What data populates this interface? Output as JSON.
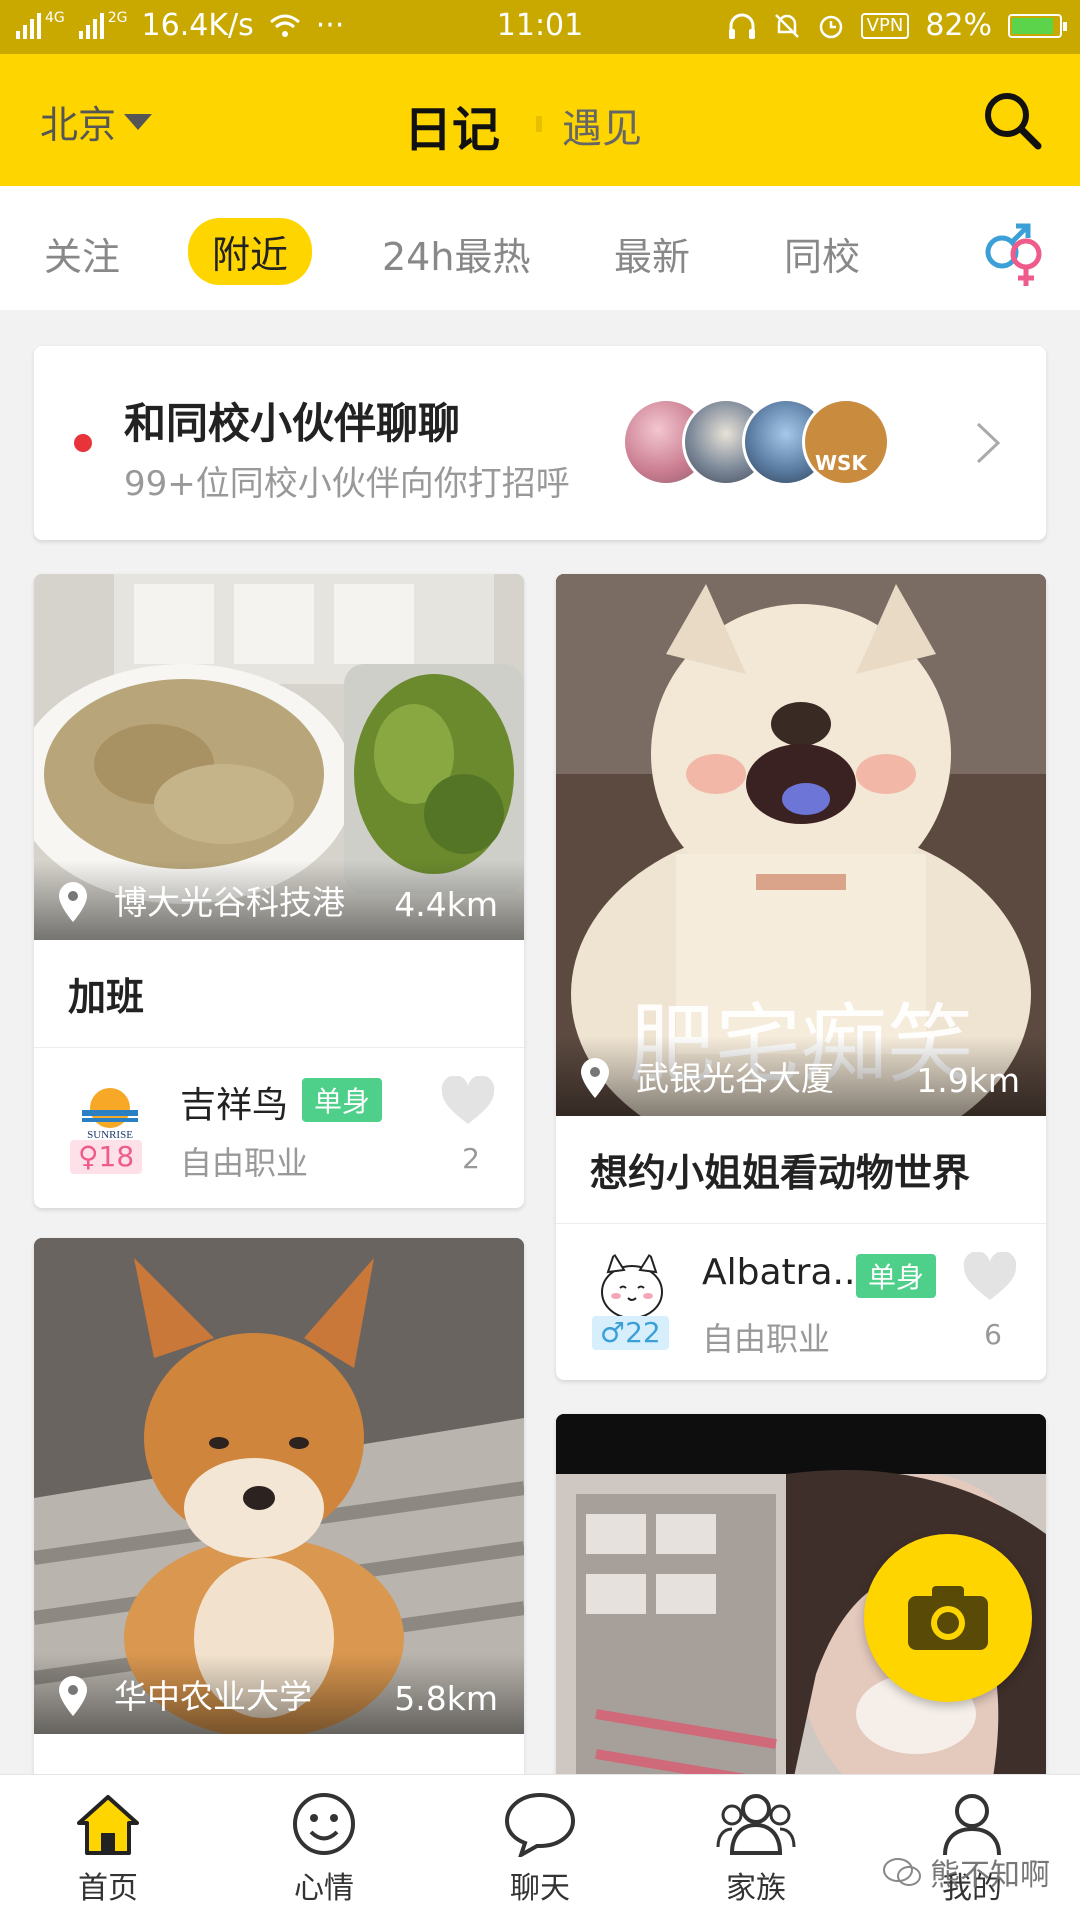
{
  "status_bar": {
    "network_left": "4G",
    "network_right": "2G",
    "speed": "16.4K/s",
    "more": "···",
    "time": "11:01",
    "vpn": "VPN",
    "battery": "82%"
  },
  "header": {
    "city": "北京",
    "title": "日记",
    "alt_title": "遇见"
  },
  "tabs": {
    "items": [
      "关注",
      "附近",
      "24h最热",
      "最新",
      "同校"
    ],
    "active": "附近"
  },
  "banner": {
    "title": "和同校小伙伴聊聊",
    "subtitle": "99+位同校小伙伴向你打招呼",
    "avatar_label": "WSK"
  },
  "posts": [
    {
      "place": "博大光谷科技港",
      "distance": "4.4km",
      "caption": "加班",
      "user": "吉祥鸟",
      "status": "单身",
      "age": "♀18",
      "job": "自由职业",
      "likes": "2",
      "avatar_text": "SUNRISE"
    },
    {
      "place": "武银光谷大厦",
      "distance": "1.9km",
      "caption": "想约小姐姐看动物世界",
      "user": "Albatra...",
      "status": "单身",
      "age": "♂22",
      "job": "自由职业",
      "likes": "6",
      "overlay_text": "肥宅痴笑"
    },
    {
      "place": "华中农业大学",
      "distance": "5.8km"
    }
  ],
  "bottom_nav": {
    "home": "首页",
    "mood": "心情",
    "chat": "聊天",
    "family": "家族",
    "me": "我的"
  },
  "watermark": "熊不知啊",
  "colors": {
    "brand_yellow": "#ffd500",
    "status_bar": "#c9a900",
    "single_badge": "#4fd08a",
    "female": "#ef5b8a",
    "male": "#3ba0d8"
  },
  "icons": {
    "search": "search-icon",
    "gender": "gender-icon",
    "camera": "camera-icon",
    "heart": "heart-icon",
    "pin": "location-pin-icon"
  }
}
